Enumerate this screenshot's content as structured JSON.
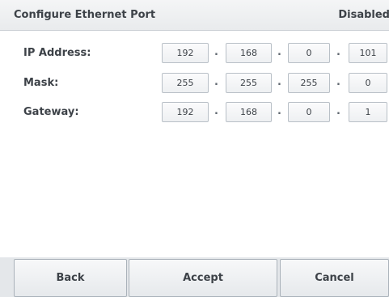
{
  "header": {
    "title": "Configure Ethernet Port",
    "status": "Disabled"
  },
  "fields": [
    {
      "label": "IP Address:",
      "octets": [
        "192",
        "168",
        "0",
        "101"
      ]
    },
    {
      "label": "Mask:",
      "octets": [
        "255",
        "255",
        "255",
        "0"
      ]
    },
    {
      "label": "Gateway:",
      "octets": [
        "192",
        "168",
        "0",
        "1"
      ]
    }
  ],
  "separator": ".",
  "buttons": {
    "back": "Back",
    "accept": "Accept",
    "cancel": "Cancel"
  }
}
